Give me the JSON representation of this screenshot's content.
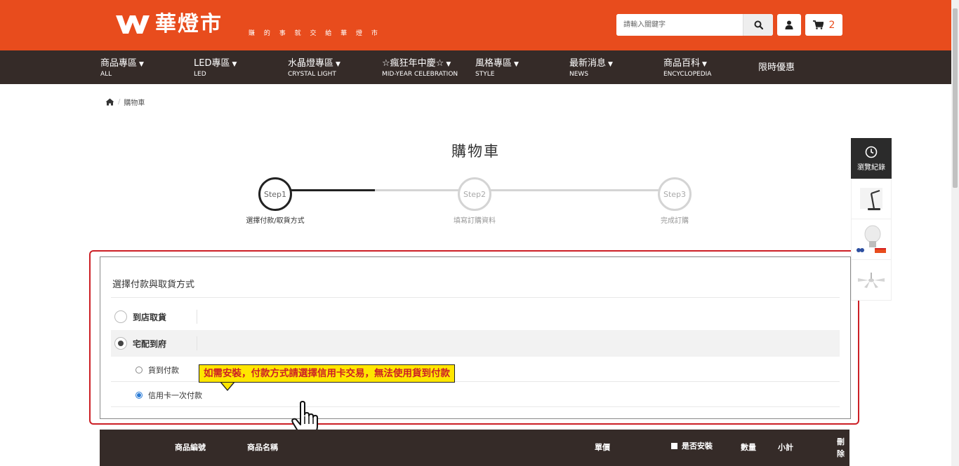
{
  "header": {
    "logo_name": "華燈市",
    "slogan": "賺 的 事 就 交 給 華 燈 市",
    "search_placeholder": "請輸入關鍵字",
    "cart_count": "2"
  },
  "nav": [
    {
      "zh": "商品專區",
      "en": "ALL"
    },
    {
      "zh": "LED專區",
      "en": "LED"
    },
    {
      "zh": "水晶燈專區",
      "en": "CRYSTAL LIGHT"
    },
    {
      "zh": "☆瘋狂年中慶☆",
      "en": "MID-YEAR CELEBRATION"
    },
    {
      "zh": "風格專區",
      "en": "STYLE"
    },
    {
      "zh": "最新消息",
      "en": "NEWS"
    },
    {
      "zh": "商品百科",
      "en": "ENCYCLOPEDIA"
    },
    {
      "zh": "限時優惠",
      "en": ""
    }
  ],
  "breadcrumb": {
    "current": "購物車"
  },
  "page_title": "購物車",
  "steps": [
    {
      "circle": "Step1",
      "label": "選擇付款/取貨方式",
      "active": true
    },
    {
      "circle": "Step2",
      "label": "填寫訂購資料",
      "active": false
    },
    {
      "circle": "Step3",
      "label": "完成訂購",
      "active": false
    }
  ],
  "payment": {
    "title": "選擇付款與取貨方式",
    "options": [
      {
        "label": "到店取貨",
        "selected": false
      },
      {
        "label": "宅配到府",
        "selected": true
      }
    ],
    "sub_options": [
      {
        "label": "貨到付款",
        "selected": false
      },
      {
        "label": "信用卡一次付款",
        "selected": true
      }
    ],
    "callout": "如需安裝，付款方式請選擇信用卡交易，無法使用貨到付款"
  },
  "table": {
    "col_code": "商品編號",
    "col_name": "商品名稱",
    "col_price": "單價",
    "col_install": "是否安裝",
    "col_qty": "數量",
    "col_subtotal": "小計",
    "col_delete": "刪除"
  },
  "sidebar": {
    "history_label": "瀏覽紀錄"
  },
  "colors": {
    "brand_orange": "#e84c1d",
    "nav_dark": "#352b28",
    "highlight_red": "#cc1f25",
    "callout_yellow": "#ffe600"
  }
}
